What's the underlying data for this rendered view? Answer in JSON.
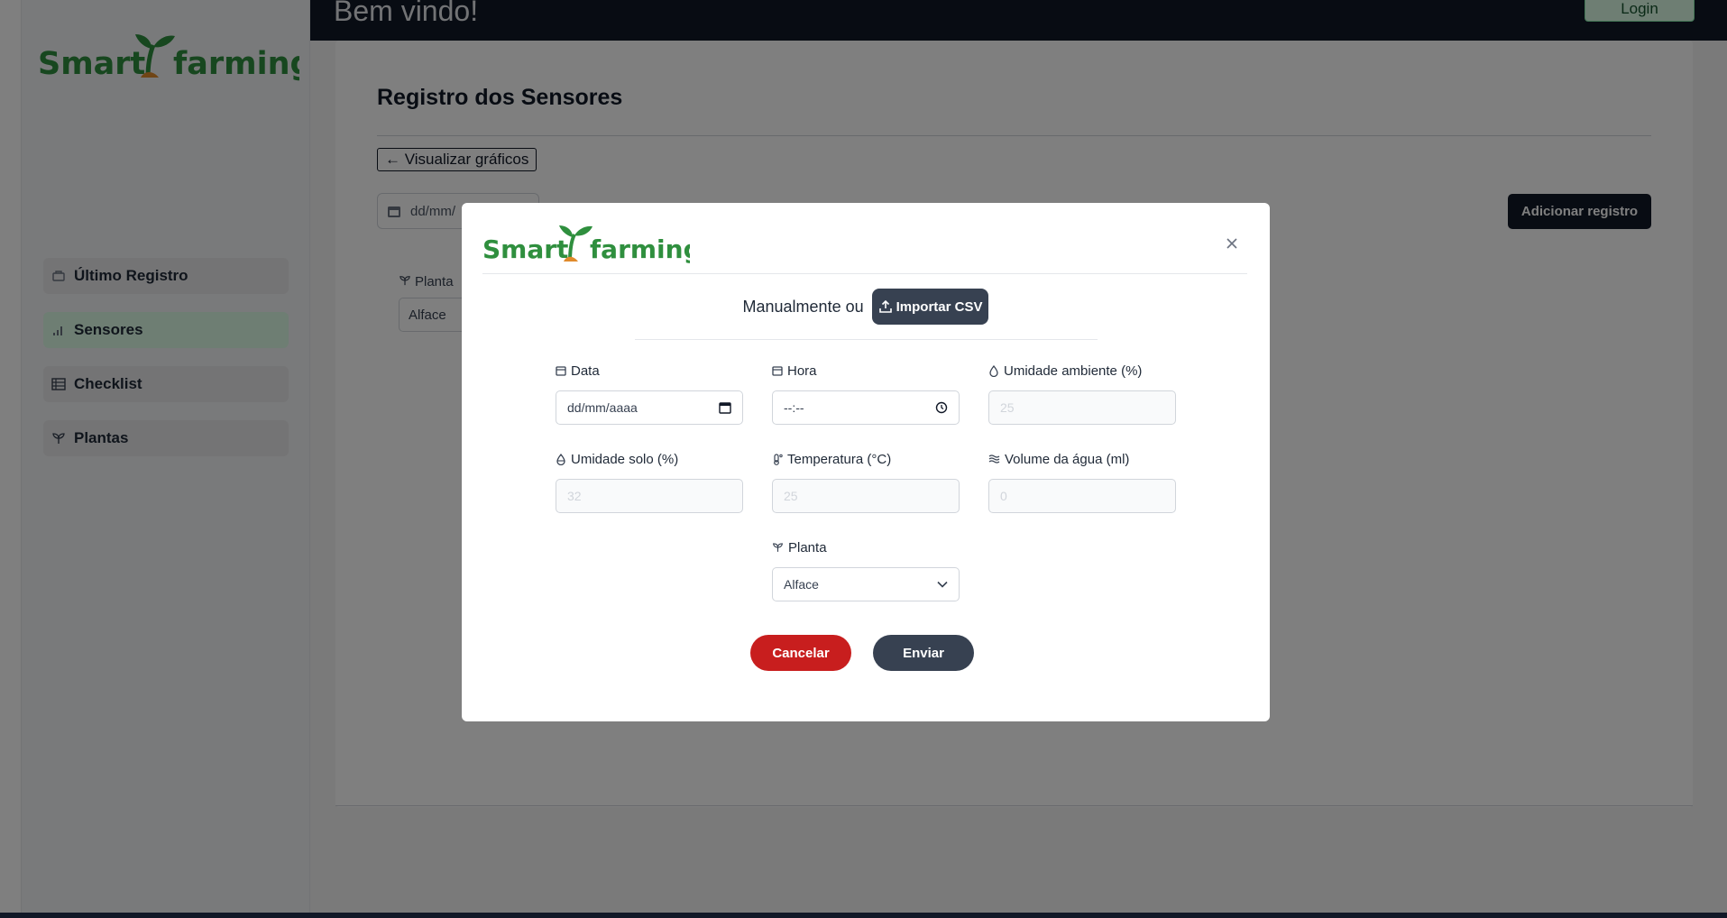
{
  "brand": {
    "name_left": "Smart",
    "name_right": "farming",
    "green": "#2f8f3e",
    "orange": "#e08a2c"
  },
  "header": {
    "welcome": "Bem vindo!",
    "login_label": "Login"
  },
  "sidebar": {
    "items": [
      {
        "label": "Último Registro",
        "icon": "history-icon"
      },
      {
        "label": "Sensores",
        "icon": "bar-chart-icon",
        "active": true
      },
      {
        "label": "Checklist",
        "icon": "table-icon"
      },
      {
        "label": "Plantas",
        "icon": "sprout-icon"
      }
    ]
  },
  "main": {
    "title": "Registro dos Sensores",
    "back_link": "← Visualizar gráficos",
    "date_filter_placeholder": "dd/mm/",
    "add_button": "Adicionar registro",
    "plant_filter_label": "Planta",
    "plant_filter_value": "Alface"
  },
  "modal": {
    "mode_text": "Manualmente ou",
    "import_label": "Importar CSV",
    "fields": {
      "data": {
        "label": "Data",
        "value": "dd/mm/aaaa"
      },
      "hora": {
        "label": "Hora",
        "value": "--:--"
      },
      "umidade_ambiente": {
        "label": "Umidade ambiente (%)",
        "placeholder": "25"
      },
      "umidade_solo": {
        "label": "Umidade solo (%)",
        "placeholder": "32"
      },
      "temperatura": {
        "label": "Temperatura (°C)",
        "placeholder": "25"
      },
      "volume_agua": {
        "label": "Volume da água (ml)",
        "placeholder": "0"
      },
      "planta": {
        "label": "Planta",
        "value": "Alface"
      }
    },
    "cancel_label": "Cancelar",
    "send_label": "Enviar"
  },
  "colors": {
    "cancel": "#c81e1e",
    "send": "#374151",
    "dark": "#111827",
    "active_nav": "#dcfce7"
  }
}
